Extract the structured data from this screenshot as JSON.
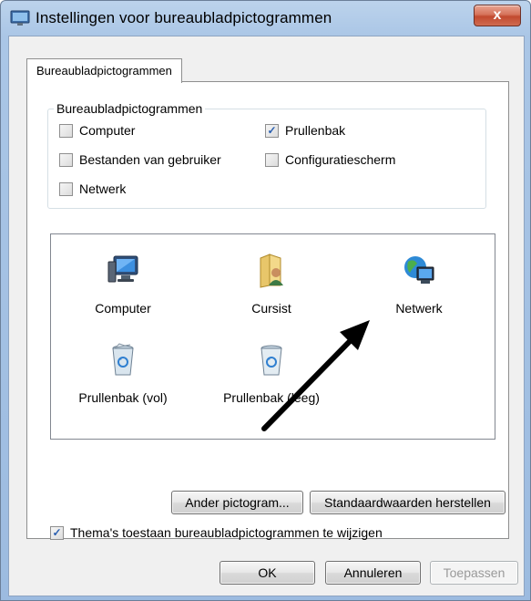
{
  "window": {
    "title": "Instellingen voor bureaubladpictogrammen",
    "close_label": "x"
  },
  "tab": {
    "label": "Bureaubladpictogrammen"
  },
  "group": {
    "legend": "Bureaubladpictogrammen",
    "checkboxes": [
      {
        "label": "Computer",
        "checked": false
      },
      {
        "label": "Prullenbak",
        "checked": true
      },
      {
        "label": "Bestanden van gebruiker",
        "checked": false
      },
      {
        "label": "Configuratiescherm",
        "checked": false
      },
      {
        "label": "Netwerk",
        "checked": false
      }
    ]
  },
  "icons": [
    {
      "label": "Computer",
      "icon": "computer-icon"
    },
    {
      "label": "Cursist",
      "icon": "user-folder-icon"
    },
    {
      "label": "Netwerk",
      "icon": "network-icon"
    },
    {
      "label": "Prullenbak (vol)",
      "icon": "recycle-bin-full-icon"
    },
    {
      "label": "Prullenbak (leeg)",
      "icon": "recycle-bin-empty-icon"
    }
  ],
  "buttons": {
    "change_icon": "Ander pictogram...",
    "restore_default": "Standaardwaarden herstellen",
    "ok": "OK",
    "cancel": "Annuleren",
    "apply": "Toepassen"
  },
  "theme_option": {
    "label": "Thema's toestaan bureaubladpictogrammen te wijzigen",
    "checked": true
  },
  "colors": {
    "titlebar": "#aac6e6",
    "close_button": "#c24a2f",
    "arrow": "#000000"
  }
}
